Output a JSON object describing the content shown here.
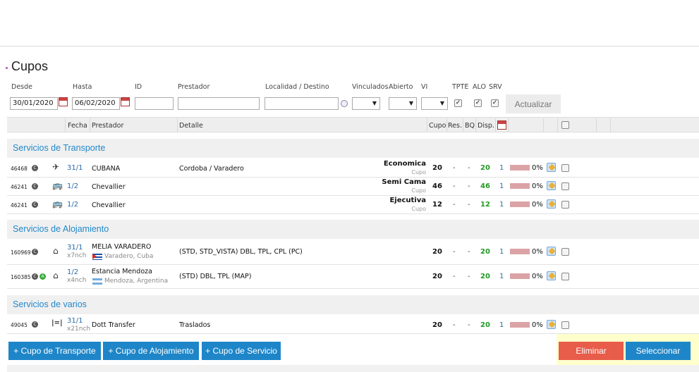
{
  "page_title": "Cupos",
  "filters": {
    "desde_label": "Desde",
    "desde_value": "30/01/2020",
    "hasta_label": "Hasta",
    "hasta_value": "06/02/2020",
    "id_label": "ID",
    "prestador_label": "Prestador",
    "localidad_label": "Localidad / Destino",
    "vinculados_label": "Vinculados",
    "abierto_label": "Abierto",
    "vi_label": "VI",
    "tpte_label": "TPTE",
    "alo_label": "ALO",
    "srv_label": "SRV",
    "tpte_checked": true,
    "alo_checked": true,
    "srv_checked": true,
    "actualizar_label": "Actualizar"
  },
  "table_headers": {
    "fecha": "Fecha",
    "prestador": "Prestador",
    "detalle": "Detalle",
    "cupo": "Cupo",
    "res": "Res.",
    "bq": "BQ",
    "disp": "Disp."
  },
  "sections": {
    "transporte": "Servicios de Transporte",
    "alojamiento": "Servicios de Alojamiento",
    "varios": "Servicios de varios"
  },
  "transporte_rows": [
    {
      "id": "46468",
      "icon": "airplane-icon",
      "date": "31/1",
      "prestador": "CUBANA",
      "detalle": "Cordoba / Varadero",
      "categoria": "Economica",
      "cupo_label": "Cupo",
      "cupo": "20",
      "res": "-",
      "bq": "-",
      "disp": "20",
      "vi": "1",
      "pct": "0%"
    },
    {
      "id": "46241",
      "icon": "bus-icon",
      "date": "1/2",
      "prestador": "Chevallier",
      "detalle": "",
      "categoria": "Semi Cama",
      "cupo_label": "Cupo",
      "cupo": "46",
      "res": "-",
      "bq": "-",
      "disp": "46",
      "vi": "1",
      "pct": "0%"
    },
    {
      "id": "46241",
      "icon": "bus-icon",
      "date": "1/2",
      "prestador": "Chevallier",
      "detalle": "",
      "categoria": "Ejecutiva",
      "cupo_label": "Cupo",
      "cupo": "12",
      "res": "-",
      "bq": "-",
      "disp": "12",
      "vi": "1",
      "pct": "0%"
    }
  ],
  "alojamiento_rows": [
    {
      "id": "160969",
      "icon": "hotel-icon",
      "date": "31/1",
      "nights": "x7nch",
      "prestador": "MELIA VARADERO",
      "location": "Varadero, Cuba",
      "flag": "cuba-flag-icon",
      "detalle": "(STD, STD_VISTA) DBL, TPL, CPL (PC)",
      "cupo": "20",
      "res": "-",
      "bq": "-",
      "disp": "20",
      "vi": "1",
      "pct": "0%"
    },
    {
      "id": "160385",
      "icon": "hotel-icon",
      "date": "1/2",
      "nights": "x4nch",
      "prestador": "Estancia Mendoza",
      "location": "Mendoza, Argentina",
      "flag": "argentina-flag-icon",
      "detalle": "(STD) DBL, TPL (MAP)",
      "cupo": "20",
      "res": "-",
      "bq": "-",
      "disp": "20",
      "vi": "1",
      "pct": "0%"
    }
  ],
  "varios_rows": [
    {
      "id": "49045",
      "icon": "transfer-icon",
      "date": "31/1",
      "nights": "x21nch",
      "prestador": "Dott Transfer",
      "detalle": "Traslados",
      "cupo": "20",
      "res": "-",
      "bq": "-",
      "disp": "20",
      "vi": "1",
      "pct": "0%"
    }
  ],
  "footer": {
    "add_transporte": "+ Cupo de Transporte",
    "add_alojamiento": "+ Cupo de Alojamiento",
    "add_servicio": "+ Cupo de Servicio",
    "eliminar": "Eliminar",
    "seleccionar": "Seleccionar"
  },
  "colors": {
    "accent_blue": "#1e86c8",
    "danger_red": "#e85c4a",
    "section_text": "#2288cc",
    "disp_green": "#229922"
  }
}
